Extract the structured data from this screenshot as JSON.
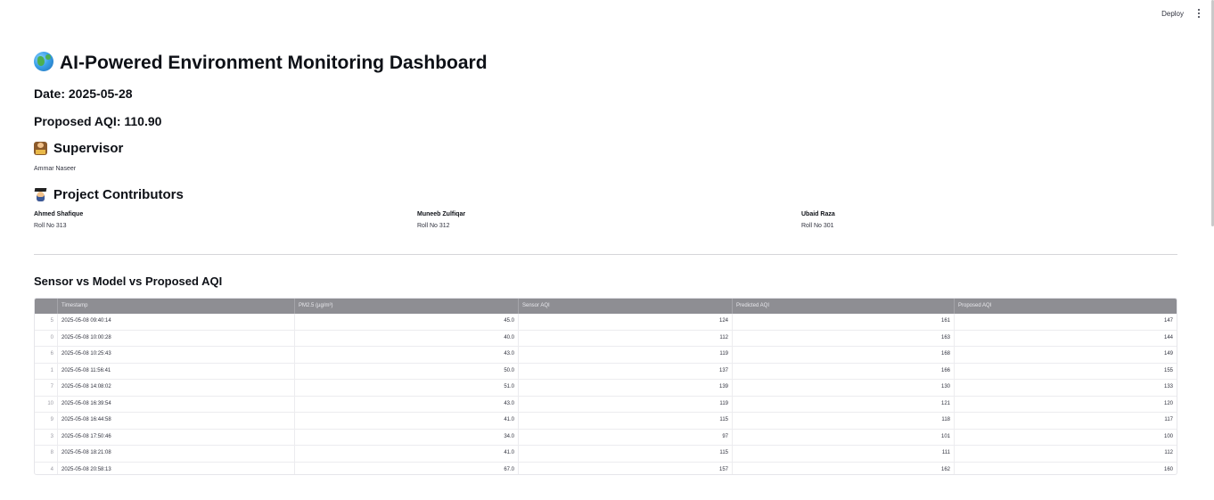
{
  "header": {
    "deploy_label": "Deploy",
    "menu_icon": "kebab-menu-icon"
  },
  "title": {
    "icon": "globe-icon",
    "text": "AI-Powered Environment Monitoring Dashboard"
  },
  "date_text": "Date: 2025-05-28",
  "proposed_aqi_text": "Proposed AQI: 110.90",
  "supervisor": {
    "icon": "supervisor-icon",
    "heading": "Supervisor",
    "name": "Ammar Naseer"
  },
  "contributors": {
    "icon": "student-icon",
    "heading": "Project Contributors",
    "people": [
      {
        "name": "Ahmed Shafique",
        "roll": "Roll No 313"
      },
      {
        "name": "Muneeb Zulfiqar",
        "roll": "Roll No 312"
      },
      {
        "name": "Ubaid Raza",
        "roll": "Roll No 301"
      }
    ]
  },
  "table_section": {
    "heading": "Sensor vs Model vs Proposed AQI",
    "columns": [
      "",
      "Timestamp",
      "PM2.5 (µg/m³)",
      "Sensor AQI",
      "Predicted AQI",
      "Proposed AQI"
    ],
    "rows": [
      [
        "5",
        "2025-05-08 09:40:14",
        "45.0",
        "124",
        "161",
        "147"
      ],
      [
        "0",
        "2025-05-08 10:00:28",
        "40.0",
        "112",
        "163",
        "144"
      ],
      [
        "6",
        "2025-05-08 10:25:43",
        "43.0",
        "119",
        "168",
        "149"
      ],
      [
        "1",
        "2025-05-08 11:56:41",
        "50.0",
        "137",
        "166",
        "155"
      ],
      [
        "7",
        "2025-05-08 14:08:02",
        "51.0",
        "139",
        "130",
        "133"
      ],
      [
        "10",
        "2025-05-08 16:39:54",
        "43.0",
        "119",
        "121",
        "120"
      ],
      [
        "9",
        "2025-05-08 16:44:58",
        "41.0",
        "115",
        "118",
        "117"
      ],
      [
        "3",
        "2025-05-08 17:50:46",
        "34.0",
        "97",
        "101",
        "100"
      ],
      [
        "8",
        "2025-05-08 18:21:08",
        "41.0",
        "115",
        "111",
        "112"
      ],
      [
        "4",
        "2025-05-08 20:58:13",
        "67.0",
        "157",
        "162",
        "160"
      ]
    ]
  }
}
